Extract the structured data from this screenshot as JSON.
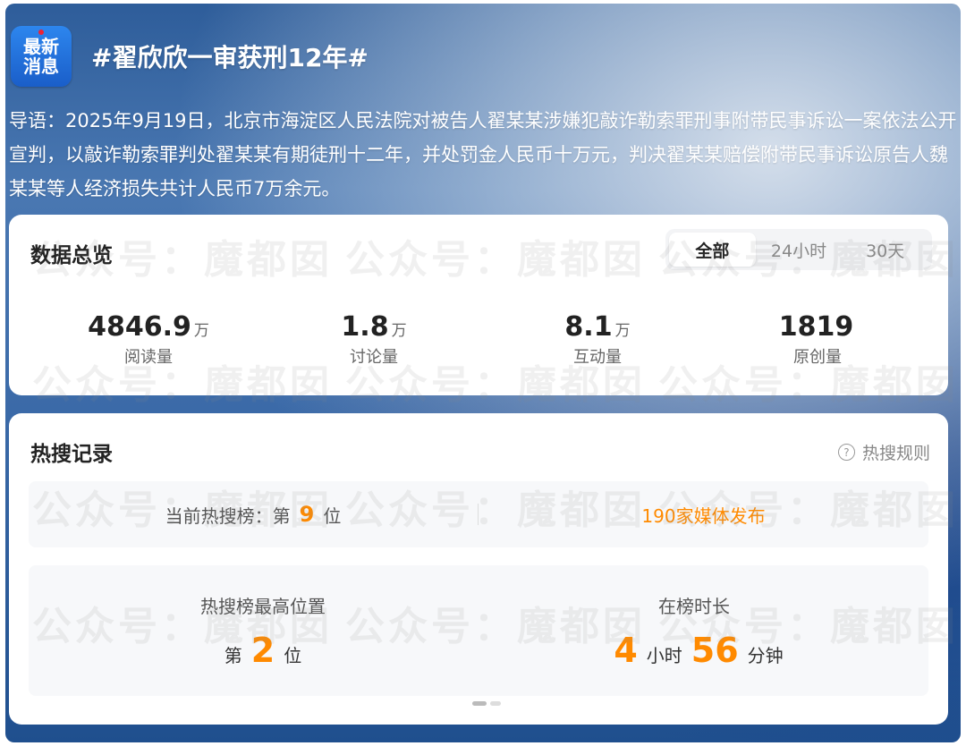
{
  "header": {
    "logo_line1": "最新",
    "logo_line2": "消息",
    "topic": "#翟欣欣一审获刑12年#"
  },
  "intro": "导语：2025年9月19日，北京市海淀区人民法院对被告人翟某某涉嫌犯敲诈勒索罪刑事附带民事诉讼一案依法公开宣判，以敲诈勒索罪判处翟某某有期徒刑十二年，并处罚金人民币十万元，判决翟某某赔偿附带民事诉讼原告人魏某某等人经济损失共计人民币7万余元。",
  "overview": {
    "title": "数据总览",
    "tabs": [
      "全部",
      "24小时",
      "30天"
    ],
    "active_tab": "全部",
    "stats": [
      {
        "value": "4846.9",
        "unit": "万",
        "label": "阅读量"
      },
      {
        "value": "1.8",
        "unit": "万",
        "label": "讨论量"
      },
      {
        "value": "8.1",
        "unit": "万",
        "label": "互动量"
      },
      {
        "value": "1819",
        "unit": "",
        "label": "原创量"
      }
    ]
  },
  "hot": {
    "title": "热搜记录",
    "rules_label": "热搜规则",
    "current_rank_prefix": "当前热搜榜：第",
    "current_rank": "9",
    "current_rank_suffix": "位",
    "media_count": "190家媒体发布",
    "highest_label": "热搜榜最高位置",
    "highest_prefix": "第",
    "highest_rank": "2",
    "highest_suffix": "位",
    "duration_label": "在榜时长",
    "duration_hours": "4",
    "duration_hours_unit": "小时",
    "duration_minutes": "56",
    "duration_minutes_unit": "分钟"
  },
  "watermark_text": "公众号：魔都囡"
}
